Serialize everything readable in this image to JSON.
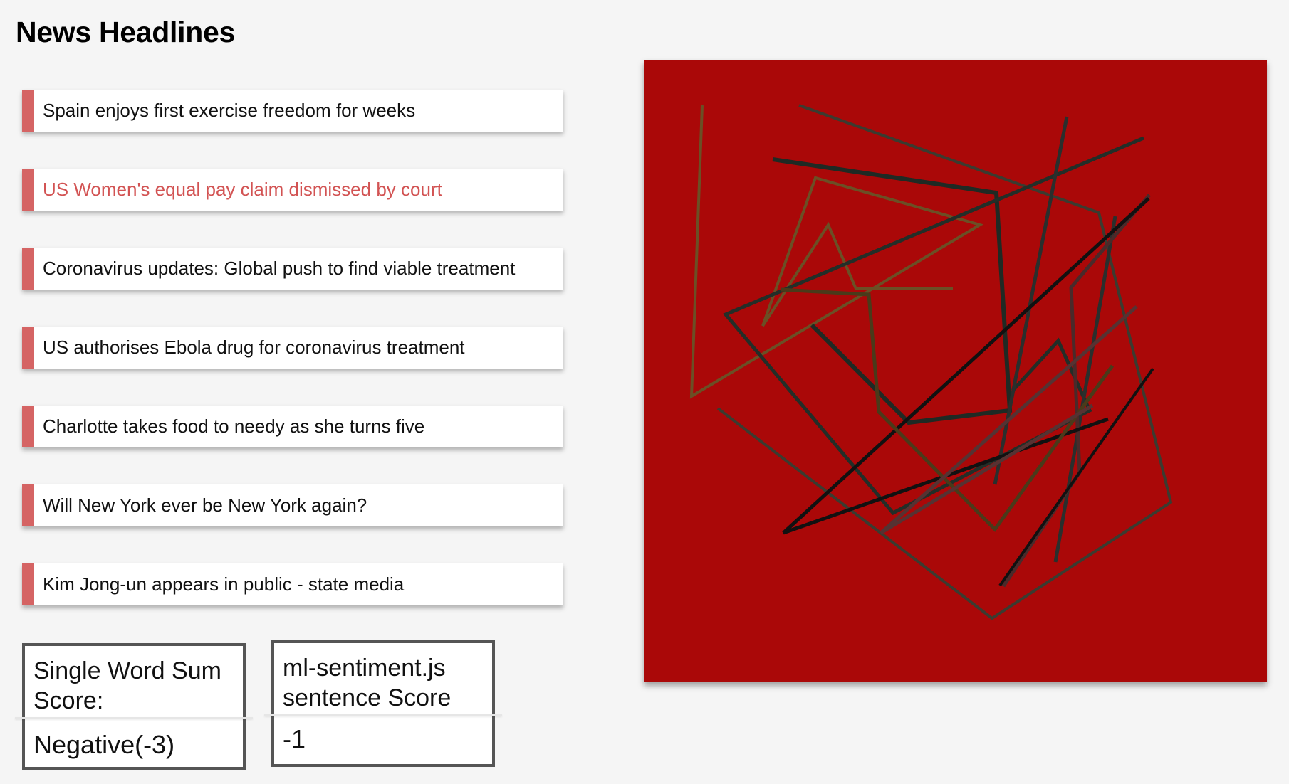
{
  "page": {
    "title": "News Headlines"
  },
  "headlines": [
    {
      "label": "Spain enjoys first exercise freedom for weeks",
      "active": false
    },
    {
      "label": "US Women's equal pay claim dismissed by court",
      "active": true
    },
    {
      "label": "Coronavirus updates: Global push to find viable treatment",
      "active": false
    },
    {
      "label": "US authorises Ebola drug for coronavirus treatment",
      "active": false
    },
    {
      "label": "Charlotte takes food to needy as she turns five",
      "active": false
    },
    {
      "label": "Will New York ever be New York again?",
      "active": false
    },
    {
      "label": "Kim Jong-un appears in public - state media",
      "active": false
    }
  ],
  "scores": {
    "single_word": {
      "label": "Single Word Sum Score:",
      "value": "Negative(-3)"
    },
    "ml_sentiment": {
      "label": "ml-sentiment.js sentence Score",
      "value": "-1"
    }
  },
  "colors": {
    "headline_accent": "#d56464",
    "active_headline_text": "#d25353",
    "art_background": "#aa0808"
  }
}
